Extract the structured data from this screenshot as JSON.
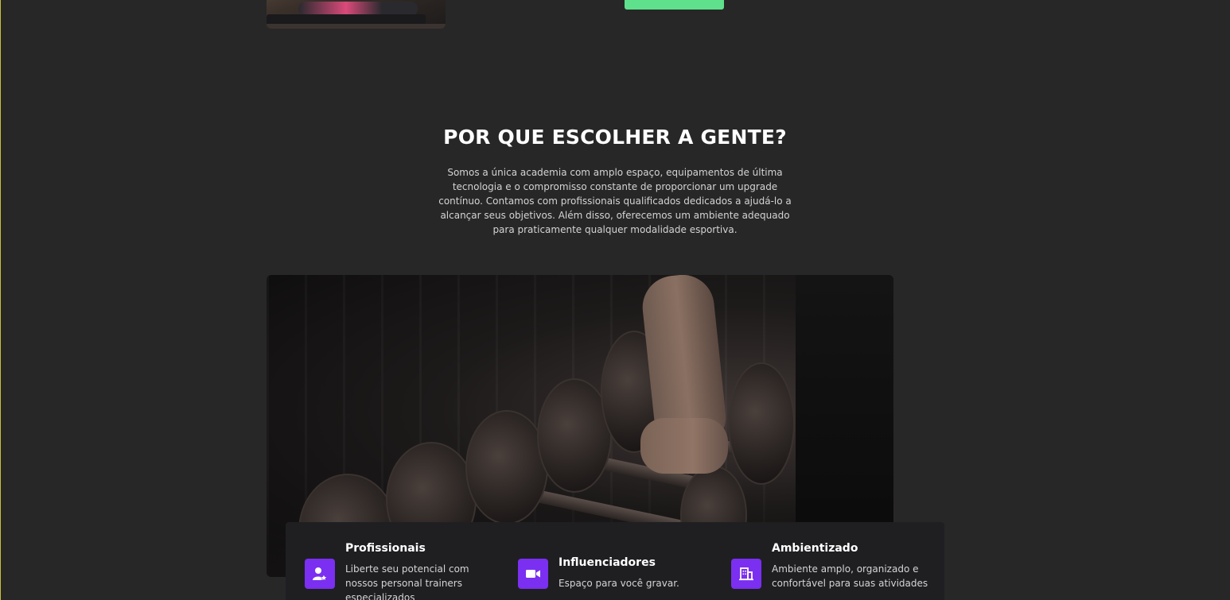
{
  "why_section": {
    "title": "POR QUE ESCOLHER A GENTE?",
    "description": "Somos a única academia com amplo espaço, equipamentos de última tecnologia e o compromisso constante de proporcionar um upgrade contínuo. Contamos com profissionais qualificados dedicados a ajudá-lo a alcançar seus objetivos. Além disso, oferecemos um ambiente adequado para praticamente qualquer modalidade esportiva."
  },
  "features": [
    {
      "title": "Profissionais",
      "text": "Liberte seu potencial com nossos personal trainers especializados",
      "icon": "trainer-star-icon"
    },
    {
      "title": "Influenciadores",
      "text": "Espaço para você gravar.",
      "icon": "video-camera-icon"
    },
    {
      "title": "Ambientizado",
      "text": "Ambiente amplo, organizado e confortável para suas atividades",
      "icon": "building-icon"
    }
  ],
  "colors": {
    "background": "#282727",
    "accent_purple": "#7b2ff0",
    "accent_green": "#5fe08c",
    "card": "#1f1f22"
  }
}
